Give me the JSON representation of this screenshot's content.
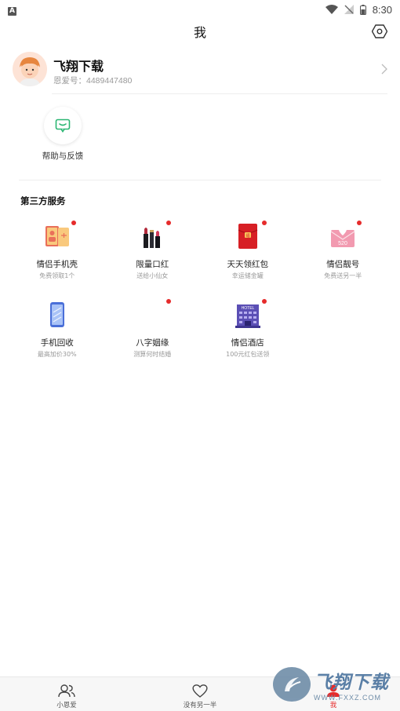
{
  "status_bar": {
    "left_icon": "A",
    "time": "8:30"
  },
  "header": {
    "title": "我"
  },
  "profile": {
    "name": "飞翔下载",
    "id_text": "恩爱号：4489447480"
  },
  "help": {
    "label": "帮助与反馈"
  },
  "third_party": {
    "title": "第三方服务",
    "items": [
      {
        "title": "情侣手机壳",
        "subtitle": "免费领取1个",
        "icon": "phone-case-icon",
        "dot": true
      },
      {
        "title": "限量口红",
        "subtitle": "送给小仙女",
        "icon": "lipstick-icon",
        "dot": true
      },
      {
        "title": "天天领红包",
        "subtitle": "幸运储金罐",
        "icon": "red-envelope-icon",
        "dot": true
      },
      {
        "title": "情侣靓号",
        "subtitle": "免费送另一半",
        "icon": "heart-envelope-icon",
        "dot": true,
        "badge": "520"
      },
      {
        "title": "手机回收",
        "subtitle": "最高加价30%",
        "icon": "phone-icon",
        "dot": false
      },
      {
        "title": "八字姻缘",
        "subtitle": "测算何时结婚",
        "icon": "bazi-icon",
        "dot": true
      },
      {
        "title": "情侣酒店",
        "subtitle": "100元红包送领",
        "icon": "hotel-icon",
        "dot": true,
        "badge": "HOTEL"
      }
    ]
  },
  "tabs": [
    {
      "label": "小恩爱",
      "icon": "users-icon",
      "active": false
    },
    {
      "label": "没有另一半",
      "icon": "heart-outline-icon",
      "active": false
    },
    {
      "label": "我",
      "icon": "me-icon",
      "active": true
    }
  ],
  "watermark": {
    "title": "飞翔下载",
    "url": "WWW.FXXZ.COM"
  },
  "colors": {
    "accent_red": "#e62b2b",
    "help_green": "#2bb673",
    "watermark_blue": "#5a7fa6"
  }
}
